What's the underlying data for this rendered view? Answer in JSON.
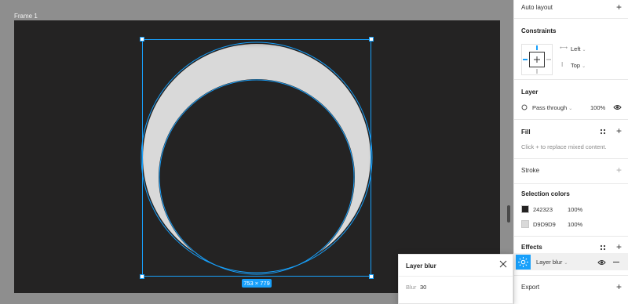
{
  "canvas": {
    "frame_label": "Frame 1",
    "dimensions_label": "753 × 779",
    "colors": {
      "canvas_bg": "#8e8e8e",
      "frame_bg": "#242323",
      "selection": "#18a0fb",
      "shape_fill": "#d9d9d9"
    }
  },
  "panel": {
    "auto_layout": {
      "title": "Auto layout"
    },
    "constraints": {
      "title": "Constraints",
      "horizontal": "Left",
      "vertical": "Top"
    },
    "layer": {
      "title": "Layer",
      "blend_mode": "Pass through",
      "opacity": "100%"
    },
    "fill": {
      "title": "Fill",
      "hint": "Click + to replace mixed content."
    },
    "stroke": {
      "title": "Stroke"
    },
    "selection_colors": {
      "title": "Selection colors",
      "items": [
        {
          "hex": "242323",
          "opacity": "100%",
          "color": "#242323"
        },
        {
          "hex": "D9D9D9",
          "opacity": "100%",
          "color": "#d9d9d9"
        }
      ]
    },
    "effects": {
      "title": "Effects",
      "items": [
        {
          "type": "Layer blur"
        }
      ]
    },
    "export": {
      "title": "Export"
    }
  },
  "popup": {
    "title": "Layer blur",
    "blur_label": "Blur",
    "blur_value": "30"
  }
}
